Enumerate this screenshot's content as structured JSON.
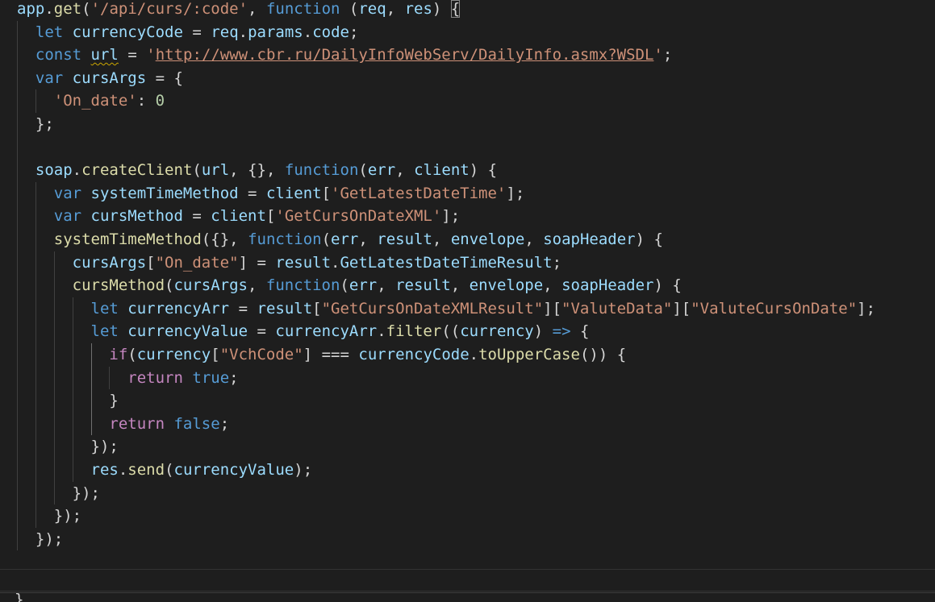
{
  "editor": {
    "theme": "Dark+",
    "colors": {
      "background": "#1e1e1e",
      "identifier": "#9cdcfe",
      "function": "#dcdcaa",
      "keyword": "#569cd6",
      "control": "#c586c0",
      "string": "#ce9178",
      "number": "#b5cea8",
      "punctuation": "#d4d4d4"
    },
    "code_lines": [
      "app.get('/api/curs/:code', function (req, res) {",
      "  let currencyCode = req.params.code;",
      "  const url = 'http://www.cbr.ru/DailyInfoWebServ/DailyInfo.asmx?WSDL';",
      "  var cursArgs = {",
      "    'On_date': 0",
      "  };",
      "",
      "  soap.createClient(url, {}, function(err, client) {",
      "    var systemTimeMethod = client['GetLatestDateTime'];",
      "    var cursMethod = client['GetCursOnDateXML'];",
      "    systemTimeMethod({}, function(err, result, envelope, soapHeader) {",
      "      cursArgs[\"On_date\"] = result.GetLatestDateTimeResult;",
      "      cursMethod(cursArgs, function(err, result, envelope, soapHeader) {",
      "        let currencyArr = result[\"GetCursOnDateXMLResult\"][\"ValuteData\"][\"ValuteCursOnDate\"];",
      "        let currencyValue = currencyArr.filter((currency) => {",
      "          if(currency[\"VchCode\"] === currencyCode.toUpperCase()) {",
      "            return true;",
      "          }",
      "          return false;",
      "        });",
      "        res.send(currencyValue);",
      "      });",
      "    });",
      "  });",
      "",
      ""
    ],
    "bottom_fragment": "}"
  }
}
